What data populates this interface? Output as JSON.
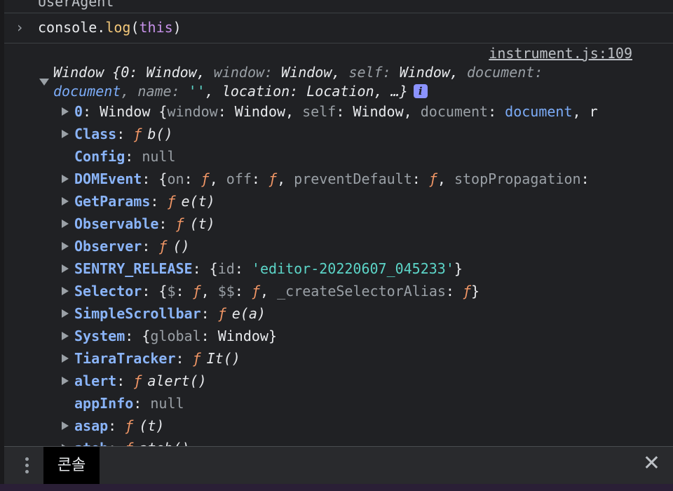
{
  "top_line": "UserAgent",
  "input": {
    "prefix": "console.",
    "fn": "log",
    "open": "(",
    "arg": "this",
    "close": ")"
  },
  "source": "instrument.js:109",
  "summary": {
    "line1_a": "Window {0: Window, ",
    "line1_b": "window: ",
    "line1_c": "Window, ",
    "line1_d": "self: ",
    "line1_e": "Window, ",
    "line1_f": "document:",
    "line2_a": "document",
    "line2_b": ", name: ",
    "line2_c": "''",
    "line2_d": ", location: Location, …}",
    "info": "i"
  },
  "props": [
    {
      "key": "0",
      "expandable": true,
      "kind": "obj",
      "value": "Window {window: Window, self: Window, document: document, r"
    },
    {
      "key": "Class",
      "expandable": true,
      "kind": "fn",
      "sig": "b()"
    },
    {
      "key": "Config",
      "expandable": false,
      "kind": "null",
      "value": "null"
    },
    {
      "key": "DOMEvent",
      "expandable": true,
      "kind": "obj",
      "value": "{on: ƒ, off: ƒ, preventDefault: ƒ, stopPropagation:"
    },
    {
      "key": "GetParams",
      "expandable": true,
      "kind": "fn",
      "sig": "e(t)"
    },
    {
      "key": "Observable",
      "expandable": true,
      "kind": "fn",
      "sig": "(t)"
    },
    {
      "key": "Observer",
      "expandable": true,
      "kind": "fn",
      "sig": "()"
    },
    {
      "key": "SENTRY_RELEASE",
      "expandable": true,
      "kind": "obj",
      "value": "{id: 'editor-20220607_045233'}"
    },
    {
      "key": "Selector",
      "expandable": true,
      "kind": "obj",
      "value": "{$: ƒ, $$: ƒ, _createSelectorAlias: ƒ}"
    },
    {
      "key": "SimpleScrollbar",
      "expandable": true,
      "kind": "fn",
      "sig": "e(a)"
    },
    {
      "key": "System",
      "expandable": true,
      "kind": "obj",
      "value": "{global: Window}"
    },
    {
      "key": "TiaraTracker",
      "expandable": true,
      "kind": "fn",
      "sig": "It()"
    },
    {
      "key": "alert",
      "expandable": true,
      "kind": "fn",
      "sig": "alert()"
    },
    {
      "key": "appInfo",
      "expandable": false,
      "kind": "null",
      "value": "null"
    },
    {
      "key": "asap",
      "expandable": true,
      "kind": "fn",
      "sig": "(t)"
    },
    {
      "key": "atob",
      "expandable": true,
      "kind": "fn",
      "sig": "atob()"
    }
  ],
  "drawer": {
    "tab_label": "콘솔",
    "close_glyph": "✕"
  },
  "fn_glyph": "ƒ",
  "colon": ": "
}
